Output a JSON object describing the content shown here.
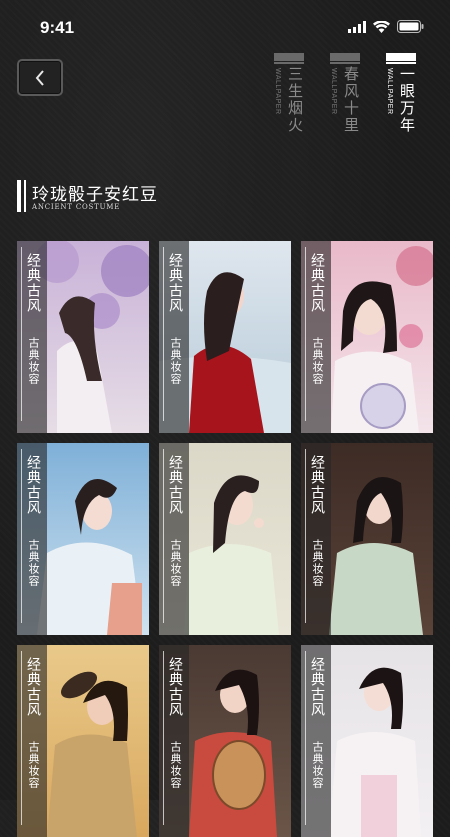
{
  "status": {
    "time": "9:41"
  },
  "header": {
    "back_label": "‹",
    "tabs": [
      {
        "zh": "三生烟火",
        "en": "WALLPAPER",
        "active": false
      },
      {
        "zh": "春风十里",
        "en": "WALLPAPER",
        "active": false
      },
      {
        "zh": "一眼万年",
        "en": "WALLPAPER",
        "active": true
      }
    ]
  },
  "section": {
    "title": "玲珑骰子安红豆",
    "subtitle": "ANCIENT COSTUME"
  },
  "cards": [
    {
      "tag": "经典古风",
      "sub": "古典妆容",
      "theme": "purple wisteria"
    },
    {
      "tag": "经典古风",
      "sub": "古典妆容",
      "theme": "red robe by sea"
    },
    {
      "tag": "经典古风",
      "sub": "古典妆容",
      "theme": "pink blossoms fan"
    },
    {
      "tag": "经典古风",
      "sub": "古典妆容",
      "theme": "blue sky hanfu"
    },
    {
      "tag": "经典古风",
      "sub": "古典妆容",
      "theme": "light green hanfu"
    },
    {
      "tag": "经典古风",
      "sub": "古典妆容",
      "theme": "mint green hanfu"
    },
    {
      "tag": "经典古风",
      "sub": "古典妆容",
      "theme": "gold fan"
    },
    {
      "tag": "经典古风",
      "sub": "古典妆容",
      "theme": "pipa red"
    },
    {
      "tag": "经典古风",
      "sub": "古典妆容",
      "theme": "white pink hanfu"
    }
  ]
}
